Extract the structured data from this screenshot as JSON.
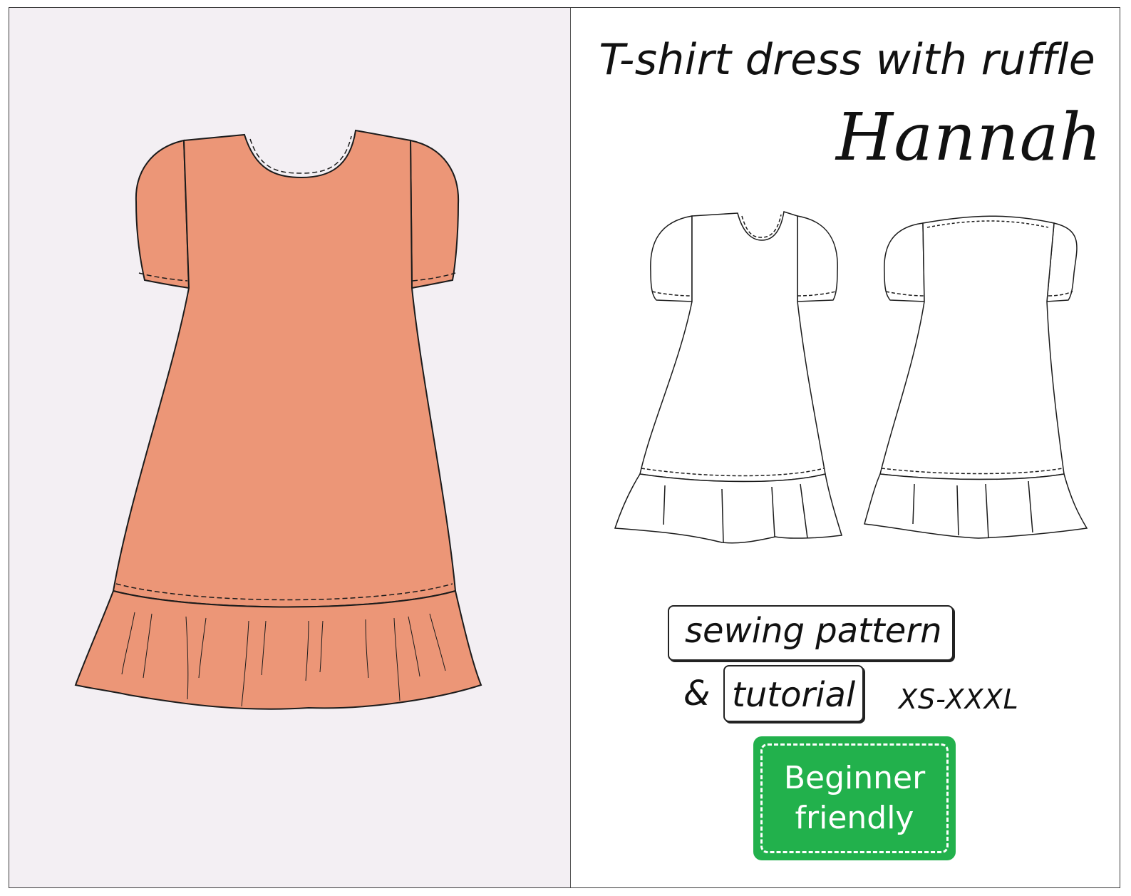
{
  "product": {
    "title": "T-shirt dress with ruffle",
    "name": "Hannah",
    "pattern_label": "sewing pattern",
    "ampersand": "&",
    "tutorial_label": "tutorial",
    "sizes": "XS-XXXL",
    "badge_lines": [
      "Beginner",
      "friendly"
    ]
  },
  "illustrations": {
    "main": "dress-colored-illustration",
    "flat_front": "dress-front-line-drawing",
    "flat_back": "dress-back-line-drawing"
  },
  "colors": {
    "dress": "#ec9677",
    "background_left": "#f3eff3",
    "badge": "#22b14c",
    "text": "#111111"
  }
}
